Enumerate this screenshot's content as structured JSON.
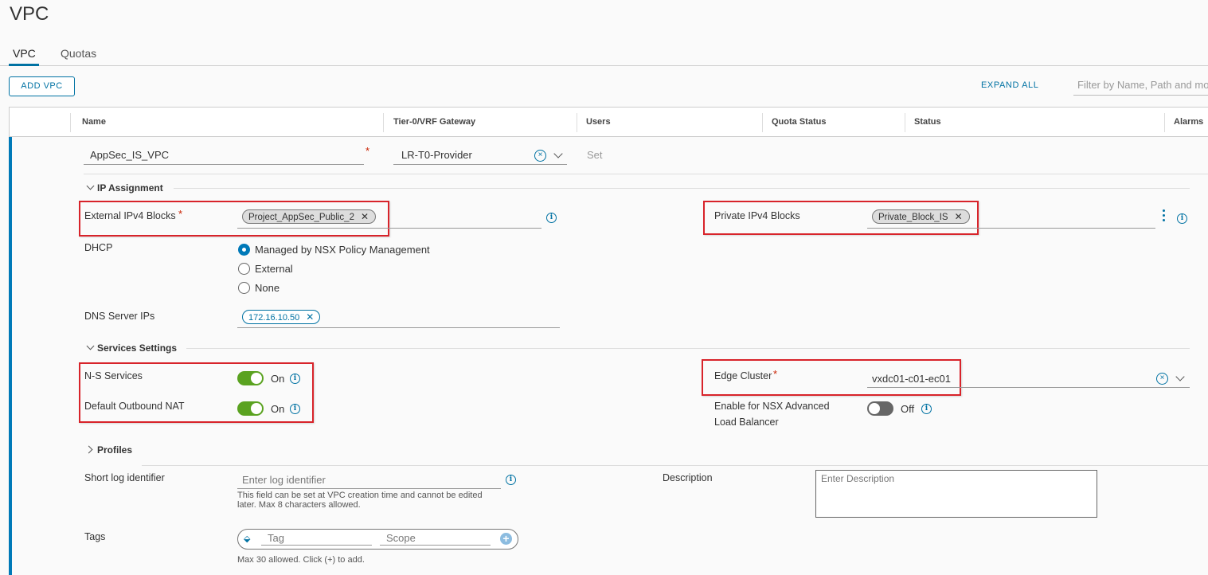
{
  "page": {
    "title": "VPC"
  },
  "tabs": [
    {
      "label": "VPC",
      "active": true
    },
    {
      "label": "Quotas",
      "active": false
    }
  ],
  "toolbar": {
    "add_label": "ADD VPC",
    "expand_all_label": "EXPAND ALL",
    "filter_placeholder": "Filter by Name, Path and more"
  },
  "columns": [
    "Name",
    "Tier-0/VRF Gateway",
    "Users",
    "Quota Status",
    "Status",
    "Alarms"
  ],
  "row": {
    "name_value": "AppSec_IS_VPC",
    "name_required": "*",
    "gateway_value": "LR-T0-Provider",
    "users_value": "Set"
  },
  "ip_assignment": {
    "section_label": "IP Assignment",
    "external_label": "External IPv4 Blocks",
    "external_required": "*",
    "external_chip": "Project_AppSec_Public_2",
    "private_label": "Private IPv4 Blocks",
    "private_chip": "Private_Block_IS",
    "dhcp_label": "DHCP",
    "dhcp_options": [
      "Managed by NSX Policy Management",
      "External",
      "None"
    ],
    "dhcp_selected": "Managed by NSX Policy Management",
    "dns_label": "DNS Server IPs",
    "dns_chip": "172.16.10.50"
  },
  "services": {
    "section_label": "Services Settings",
    "ns_label": "N-S Services",
    "ns_state": "On",
    "nat_label": "Default Outbound NAT",
    "nat_state": "On",
    "edge_label": "Edge Cluster",
    "edge_required": "*",
    "edge_value": "vxdc01-c01-ec01",
    "lb_label_line1": "Enable for NSX Advanced",
    "lb_label_line2": "Load Balancer",
    "lb_state": "Off"
  },
  "profiles": {
    "section_label": "Profiles",
    "short_log_label": "Short log identifier",
    "short_log_placeholder": "Enter log identifier",
    "short_log_hint_line1": "This field can be set at VPC creation time and cannot be edited",
    "short_log_hint_line2": "later. Max 8 characters allowed.",
    "description_label": "Description",
    "description_placeholder": "Enter Description",
    "tags_label": "Tags",
    "tag_placeholder": "Tag",
    "scope_placeholder": "Scope",
    "tags_hint": "Max 30 allowed. Click (+) to add."
  },
  "colors": {
    "accent": "#0072a3",
    "toggle_on": "#5aa220",
    "toggle_off": "#666666",
    "highlight": "#d8232a",
    "required": "#c92100"
  },
  "icons": [
    "close-icon",
    "chevron-down-icon",
    "chevron-right-icon",
    "info-icon",
    "clear-icon",
    "add-icon",
    "tag-icon",
    "kebab-menu-icon"
  ]
}
